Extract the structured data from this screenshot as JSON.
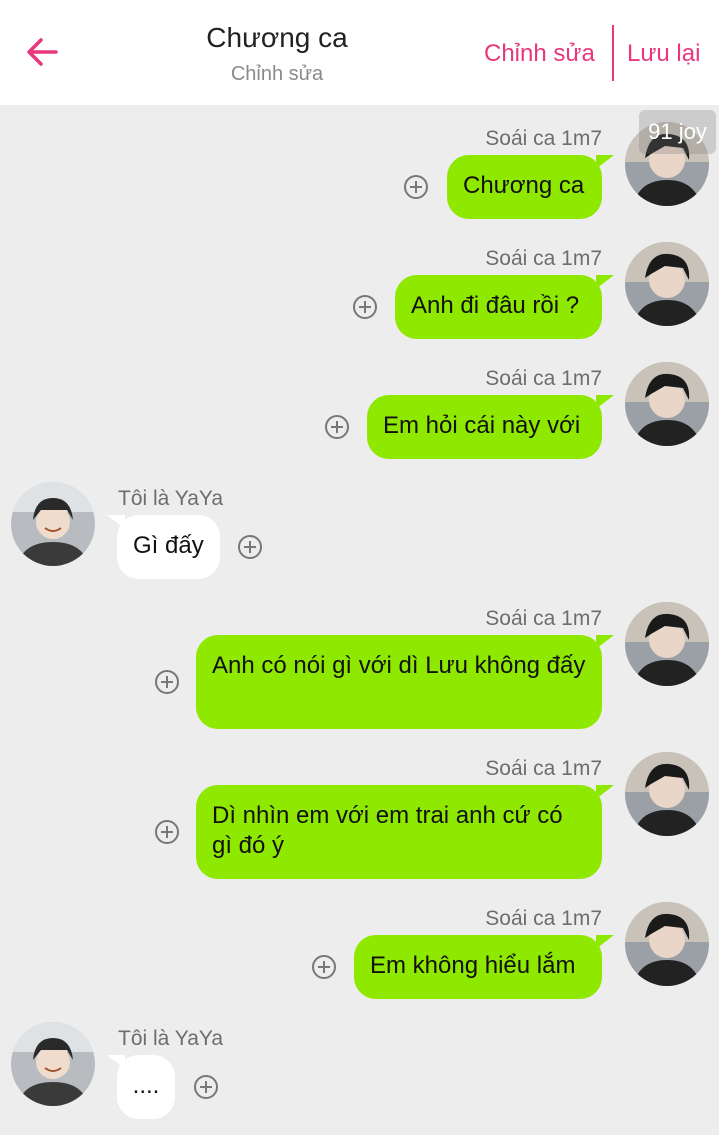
{
  "header": {
    "title": "Chương ca",
    "subtitle": "Chỉnh sửa",
    "edit_label": "Chỉnh sửa",
    "save_label": "Lưu lại"
  },
  "watermark": "91 joy",
  "messages": [
    {
      "side": "right",
      "sender": "Soái ca 1m7",
      "text": "Chương ca"
    },
    {
      "side": "right",
      "sender": "Soái ca 1m7",
      "text": "Anh đi đâu rồi ?"
    },
    {
      "side": "right",
      "sender": "Soái ca 1m7",
      "text": "Em hỏi cái này với"
    },
    {
      "side": "left",
      "sender": "Tôi là YaYa",
      "text": "Gì đấy"
    },
    {
      "side": "right",
      "sender": "Soái ca 1m7",
      "text": "Anh có nói gì với dì Lưu không đấy"
    },
    {
      "side": "right",
      "sender": "Soái ca 1m7",
      "text": "Dì nhìn em với em trai anh cứ có gì đó ý"
    },
    {
      "side": "right",
      "sender": "Soái ca 1m7",
      "text": "Em không hiểu lắm"
    },
    {
      "side": "left",
      "sender": "Tôi là YaYa",
      "text": "...."
    }
  ],
  "colors": {
    "accent": "#e8377c",
    "bubble_green": "#8fe800",
    "bubble_white": "#ffffff",
    "background": "#ededed"
  }
}
